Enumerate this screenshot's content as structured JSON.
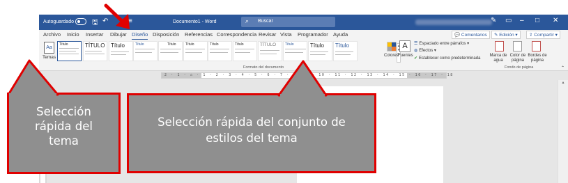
{
  "titlebar": {
    "autosave_label": "Autoguardado",
    "document_title": "Documento1 - Word",
    "search_placeholder": "Buscar",
    "background_color": "#2b579a"
  },
  "ribbon_tabs": [
    "Archivo",
    "Inicio",
    "Insertar",
    "Dibujar",
    "Diseño",
    "Disposición",
    "Referencias",
    "Correspondencia",
    "Revisar",
    "Vista",
    "Programador",
    "Ayuda"
  ],
  "active_tab": "Diseño",
  "ribbon_buttons": {
    "comments": "Comentarios",
    "editing": "Edición",
    "share": "Compartir"
  },
  "ribbon": {
    "themes_label": "Temas",
    "style_gallery": [
      "Título",
      "TÍTULO",
      "Título",
      "Título",
      "Título",
      "Título",
      "Título",
      "Título",
      "TÍTULO",
      "Título",
      "Título",
      "Título"
    ],
    "document_format_group": "Formato del documento",
    "colors_label": "Colores",
    "fonts_label": "Fuentes",
    "paragraph_spacing": "Espaciado entre párrafos",
    "effects": "Efectos",
    "set_default": "Establecer como predeterminada",
    "watermark": "Marca de agua",
    "page_color": "Color de página",
    "page_borders": "Bordes de página",
    "page_background_group": "Fondo de página"
  },
  "ruler_text": "2 · 1 · ⌂ · 1 · 2 · 3 · 4 · 5 · 6 · 7 · 8 · 9 · 10 · 11 · 12 · 13 · 14 · 15 · 16 · 17 · 18",
  "callouts": {
    "left": "Selección rápida del tema",
    "main": "Selección rápida del conjunto de estilos del tema"
  },
  "colors": {
    "callout_border": "#e00000",
    "callout_fill": "#8f8f8f",
    "arrow": "#e00000"
  }
}
